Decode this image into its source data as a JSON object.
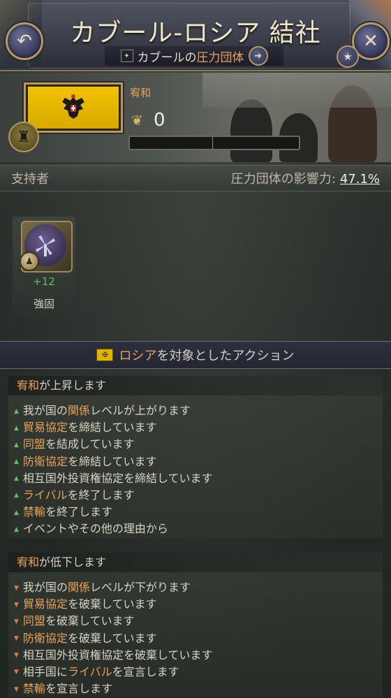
{
  "header": {
    "title": "カブール-ロシア 結社",
    "subtitle_prefix": "カブールの",
    "subtitle_highlight": "圧力団体",
    "back_icon": "back-arrow-icon",
    "close_icon": "close-icon",
    "star_icon": "star-icon",
    "navigate_icon": "arrow-right-icon"
  },
  "status": {
    "approval_label": "宥和",
    "approval_value": "0",
    "approval_bar_fill": 0
  },
  "supporters": {
    "label": "支持者",
    "influence_label": "圧力団体の影響力:",
    "influence_value": "47.1%",
    "items": [
      {
        "icon": "windmill-icon",
        "value": "+12",
        "label": "強固"
      }
    ]
  },
  "actions": {
    "title_highlight": "ロシア",
    "title_rest": "を対象としたアクション",
    "increase": {
      "header_hl": "宥和",
      "header_rest": "が上昇します",
      "items": [
        {
          "pre": "我が国の",
          "hl": "関係",
          "post": "レベルが上がります"
        },
        {
          "pre": "",
          "hl": "貿易協定",
          "post": "を締結しています"
        },
        {
          "pre": "",
          "hl": "同盟",
          "post": "を結成しています"
        },
        {
          "pre": "",
          "hl": "防衛協定",
          "post": "を締結しています"
        },
        {
          "pre": "相互国外投資権",
          "hl": "",
          "post": "協定を締結しています"
        },
        {
          "pre": "",
          "hl": "ライバル",
          "post": "を終了します"
        },
        {
          "pre": "",
          "hl": "禁輸",
          "post": "を終了します"
        },
        {
          "pre": "イベントやその他の理由から",
          "hl": "",
          "post": ""
        }
      ]
    },
    "decrease": {
      "header_hl": "宥和",
      "header_rest": "が低下します",
      "items": [
        {
          "pre": "我が国の",
          "hl": "関係",
          "post": "レベルが下がります"
        },
        {
          "pre": "",
          "hl": "貿易協定",
          "post": "を破棄しています"
        },
        {
          "pre": "",
          "hl": "同盟",
          "post": "を破棄しています"
        },
        {
          "pre": "",
          "hl": "防衛協定",
          "post": "を破棄しています"
        },
        {
          "pre": "相互国外投資権",
          "hl": "",
          "post": "協定を破棄しています"
        },
        {
          "pre": "相手国に",
          "hl": "ライバル",
          "post": "を宣言します"
        },
        {
          "pre": "",
          "hl": "禁輸",
          "post": "を宣言します"
        }
      ]
    }
  },
  "colors": {
    "highlight": "#e8a35a",
    "positive": "#5fc15f",
    "negative": "#e07a3a",
    "frame_gold": "#b7995b"
  }
}
